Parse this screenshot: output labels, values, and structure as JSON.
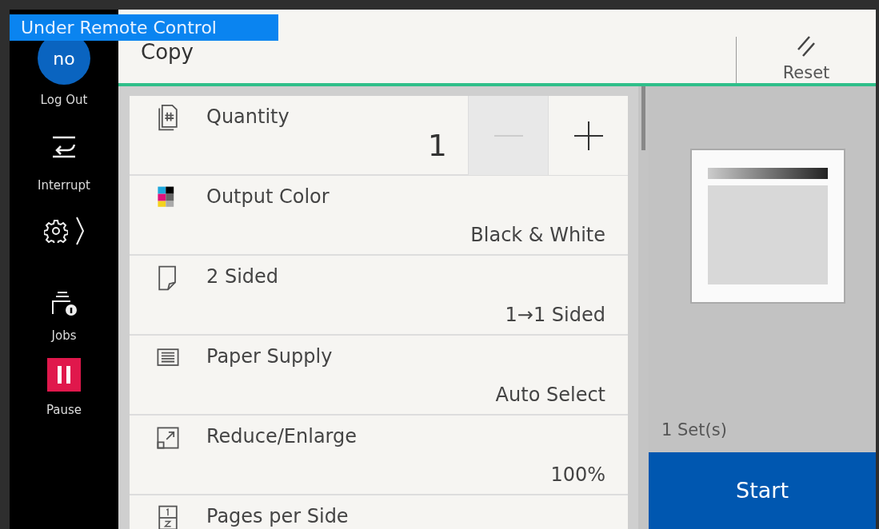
{
  "banner": "Under Remote Control",
  "sidebar": [
    {
      "kind": "user",
      "avatar": "no",
      "label": "Log Out"
    },
    {
      "kind": "interrupt",
      "label": "Interrupt"
    },
    {
      "kind": "settings"
    },
    {
      "kind": "jobs",
      "label": "Jobs"
    },
    {
      "kind": "pause",
      "label": "Pause"
    }
  ],
  "header": {
    "title": "Copy",
    "reset": "Reset"
  },
  "settings": [
    {
      "kind": "counter",
      "label": "Quantity",
      "value": "1",
      "minus_disabled": true
    },
    {
      "kind": "option",
      "label": "Output Color",
      "value": "Black & White"
    },
    {
      "kind": "option",
      "label": "2 Sided",
      "value": "1→1 Sided"
    },
    {
      "kind": "option",
      "label": "Paper Supply",
      "value": "Auto Select"
    },
    {
      "kind": "option",
      "label": "Reduce/Enlarge",
      "value": "100%"
    },
    {
      "kind": "option",
      "label": "Pages per Side"
    }
  ],
  "preview": {
    "sets": "1 Set(s)",
    "start": "Start"
  }
}
